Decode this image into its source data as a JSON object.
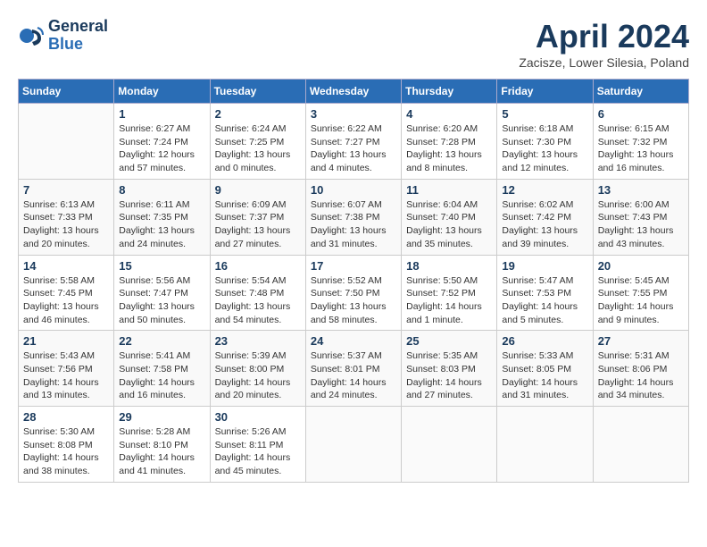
{
  "header": {
    "logo_general": "General",
    "logo_blue": "Blue",
    "title": "April 2024",
    "location": "Zacisze, Lower Silesia, Poland"
  },
  "days_of_week": [
    "Sunday",
    "Monday",
    "Tuesday",
    "Wednesday",
    "Thursday",
    "Friday",
    "Saturday"
  ],
  "weeks": [
    [
      {
        "num": "",
        "info": ""
      },
      {
        "num": "1",
        "info": "Sunrise: 6:27 AM\nSunset: 7:24 PM\nDaylight: 12 hours\nand 57 minutes."
      },
      {
        "num": "2",
        "info": "Sunrise: 6:24 AM\nSunset: 7:25 PM\nDaylight: 13 hours\nand 0 minutes."
      },
      {
        "num": "3",
        "info": "Sunrise: 6:22 AM\nSunset: 7:27 PM\nDaylight: 13 hours\nand 4 minutes."
      },
      {
        "num": "4",
        "info": "Sunrise: 6:20 AM\nSunset: 7:28 PM\nDaylight: 13 hours\nand 8 minutes."
      },
      {
        "num": "5",
        "info": "Sunrise: 6:18 AM\nSunset: 7:30 PM\nDaylight: 13 hours\nand 12 minutes."
      },
      {
        "num": "6",
        "info": "Sunrise: 6:15 AM\nSunset: 7:32 PM\nDaylight: 13 hours\nand 16 minutes."
      }
    ],
    [
      {
        "num": "7",
        "info": "Sunrise: 6:13 AM\nSunset: 7:33 PM\nDaylight: 13 hours\nand 20 minutes."
      },
      {
        "num": "8",
        "info": "Sunrise: 6:11 AM\nSunset: 7:35 PM\nDaylight: 13 hours\nand 24 minutes."
      },
      {
        "num": "9",
        "info": "Sunrise: 6:09 AM\nSunset: 7:37 PM\nDaylight: 13 hours\nand 27 minutes."
      },
      {
        "num": "10",
        "info": "Sunrise: 6:07 AM\nSunset: 7:38 PM\nDaylight: 13 hours\nand 31 minutes."
      },
      {
        "num": "11",
        "info": "Sunrise: 6:04 AM\nSunset: 7:40 PM\nDaylight: 13 hours\nand 35 minutes."
      },
      {
        "num": "12",
        "info": "Sunrise: 6:02 AM\nSunset: 7:42 PM\nDaylight: 13 hours\nand 39 minutes."
      },
      {
        "num": "13",
        "info": "Sunrise: 6:00 AM\nSunset: 7:43 PM\nDaylight: 13 hours\nand 43 minutes."
      }
    ],
    [
      {
        "num": "14",
        "info": "Sunrise: 5:58 AM\nSunset: 7:45 PM\nDaylight: 13 hours\nand 46 minutes."
      },
      {
        "num": "15",
        "info": "Sunrise: 5:56 AM\nSunset: 7:47 PM\nDaylight: 13 hours\nand 50 minutes."
      },
      {
        "num": "16",
        "info": "Sunrise: 5:54 AM\nSunset: 7:48 PM\nDaylight: 13 hours\nand 54 minutes."
      },
      {
        "num": "17",
        "info": "Sunrise: 5:52 AM\nSunset: 7:50 PM\nDaylight: 13 hours\nand 58 minutes."
      },
      {
        "num": "18",
        "info": "Sunrise: 5:50 AM\nSunset: 7:52 PM\nDaylight: 14 hours\nand 1 minute."
      },
      {
        "num": "19",
        "info": "Sunrise: 5:47 AM\nSunset: 7:53 PM\nDaylight: 14 hours\nand 5 minutes."
      },
      {
        "num": "20",
        "info": "Sunrise: 5:45 AM\nSunset: 7:55 PM\nDaylight: 14 hours\nand 9 minutes."
      }
    ],
    [
      {
        "num": "21",
        "info": "Sunrise: 5:43 AM\nSunset: 7:56 PM\nDaylight: 14 hours\nand 13 minutes."
      },
      {
        "num": "22",
        "info": "Sunrise: 5:41 AM\nSunset: 7:58 PM\nDaylight: 14 hours\nand 16 minutes."
      },
      {
        "num": "23",
        "info": "Sunrise: 5:39 AM\nSunset: 8:00 PM\nDaylight: 14 hours\nand 20 minutes."
      },
      {
        "num": "24",
        "info": "Sunrise: 5:37 AM\nSunset: 8:01 PM\nDaylight: 14 hours\nand 24 minutes."
      },
      {
        "num": "25",
        "info": "Sunrise: 5:35 AM\nSunset: 8:03 PM\nDaylight: 14 hours\nand 27 minutes."
      },
      {
        "num": "26",
        "info": "Sunrise: 5:33 AM\nSunset: 8:05 PM\nDaylight: 14 hours\nand 31 minutes."
      },
      {
        "num": "27",
        "info": "Sunrise: 5:31 AM\nSunset: 8:06 PM\nDaylight: 14 hours\nand 34 minutes."
      }
    ],
    [
      {
        "num": "28",
        "info": "Sunrise: 5:30 AM\nSunset: 8:08 PM\nDaylight: 14 hours\nand 38 minutes."
      },
      {
        "num": "29",
        "info": "Sunrise: 5:28 AM\nSunset: 8:10 PM\nDaylight: 14 hours\nand 41 minutes."
      },
      {
        "num": "30",
        "info": "Sunrise: 5:26 AM\nSunset: 8:11 PM\nDaylight: 14 hours\nand 45 minutes."
      },
      {
        "num": "",
        "info": ""
      },
      {
        "num": "",
        "info": ""
      },
      {
        "num": "",
        "info": ""
      },
      {
        "num": "",
        "info": ""
      }
    ]
  ]
}
